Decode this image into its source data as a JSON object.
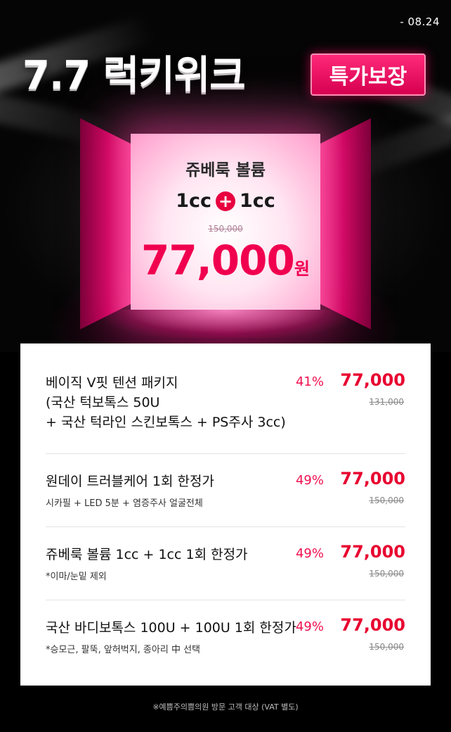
{
  "header": {
    "date": "- 08.24",
    "title": "7.7 럭키위크",
    "badge": "특가보장"
  },
  "stage": {
    "product_name": "쥬베룩 볼륨",
    "combo_left": "1cc",
    "combo_plus": "+",
    "combo_right": "1cc",
    "old_price": "150,000",
    "price": "77,000",
    "price_unit": "원"
  },
  "items": [
    {
      "name_lines": [
        "베이직 V핏 텐션 패키지",
        "(국산 턱보톡스 50U",
        "+ 국산 턱라인 스킨보톡스 + PS주사 3cc)"
      ],
      "sub": "",
      "discount": "41%",
      "price": "77,000",
      "old_price": "131,000"
    },
    {
      "name_lines": [
        "원데이 트러블케어 1회 한정가"
      ],
      "sub": "시카필 + LED 5분 + 염증주사 얼굴전체",
      "discount": "49%",
      "price": "77,000",
      "old_price": "150,000"
    },
    {
      "name_lines": [
        "쥬베룩 볼륨 1cc + 1cc 1회 한정가"
      ],
      "sub": "*이마/눈밑 제외",
      "discount": "49%",
      "price": "77,000",
      "old_price": "150,000"
    },
    {
      "name_lines": [
        "국산 바디보톡스 100U + 100U 1회 한정가"
      ],
      "sub": "*승모근, 팔뚝, 앞허벅지, 종아리 中 선택",
      "discount": "49%",
      "price": "77,000",
      "old_price": "150,000"
    }
  ],
  "footnote": "※예쁨주의쁨의원 방문 고객 대상 (VAT 별도)",
  "colors": {
    "accent": "#e8002f",
    "badge": "#e0005a",
    "panel": "#c8005a",
    "background": "#000000",
    "card": "#ffffff"
  }
}
